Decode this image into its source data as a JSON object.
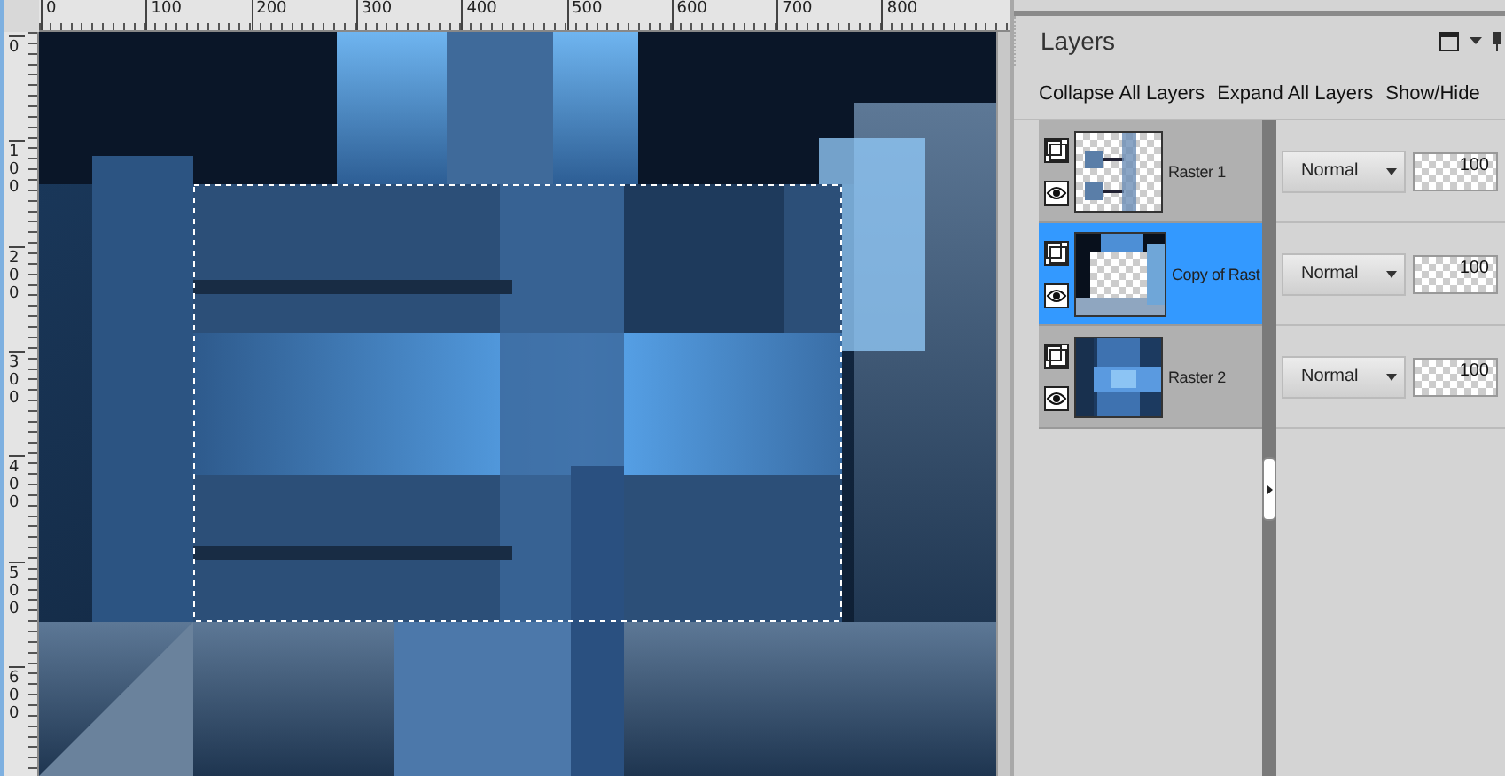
{
  "rulers": {
    "horizontal": [
      "0",
      "100",
      "200",
      "300",
      "400",
      "500",
      "600",
      "700",
      "800"
    ],
    "vertical": [
      "0",
      "100",
      "200",
      "300",
      "400",
      "500",
      "600"
    ]
  },
  "layers_panel": {
    "title": "Layers",
    "toolbar": [
      "Collapse All Layers",
      "Expand All Layers",
      "Show/Hide"
    ],
    "layers": [
      {
        "name": "Raster 1",
        "kind": "strips",
        "selected": false,
        "visible": true,
        "blend_mode": "Normal",
        "opacity": "100"
      },
      {
        "name": "Copy of Rast",
        "kind": "frame",
        "selected": true,
        "visible": true,
        "blend_mode": "Normal",
        "opacity": "100"
      },
      {
        "name": "Raster 2",
        "kind": "blocks",
        "selected": false,
        "visible": true,
        "blend_mode": "Normal",
        "opacity": "100"
      }
    ]
  }
}
